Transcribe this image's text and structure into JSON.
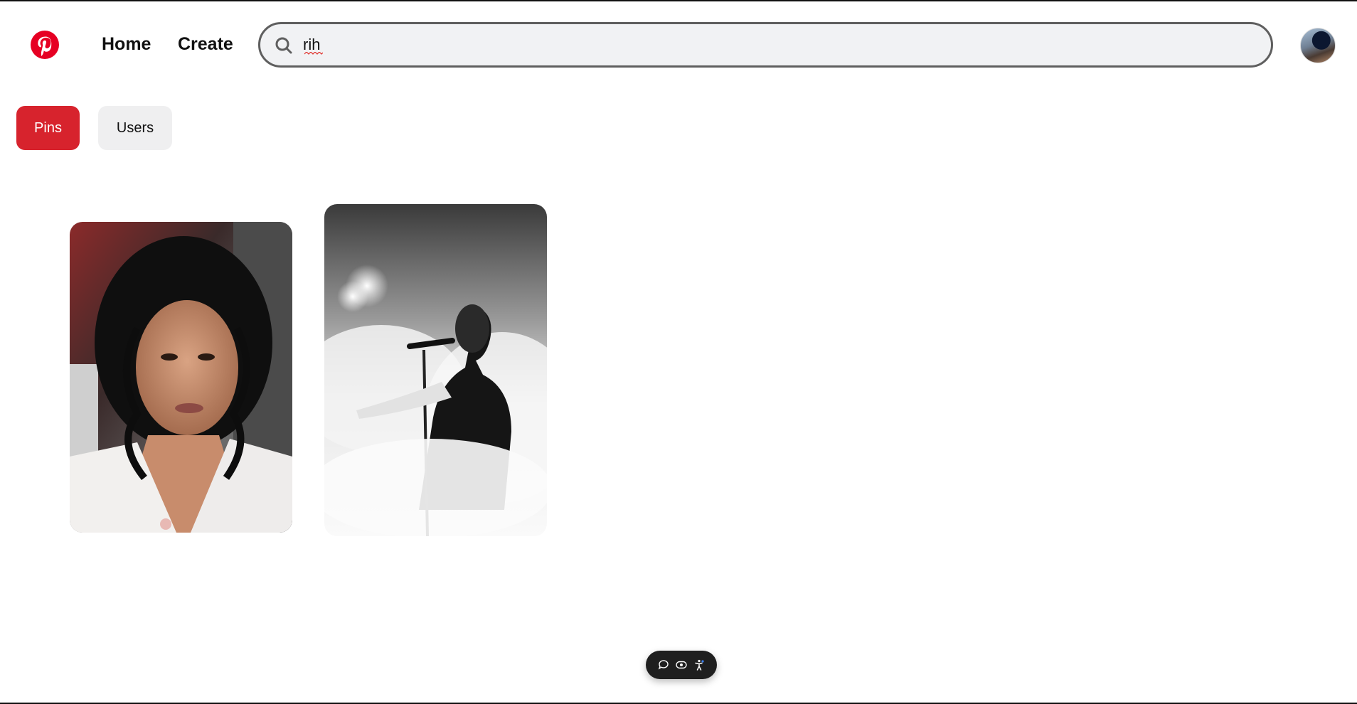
{
  "app": {
    "logo_icon": "pinterest-logo-icon",
    "brand_color": "#e60023"
  },
  "nav": {
    "home_label": "Home",
    "create_label": "Create"
  },
  "search": {
    "icon": "search-icon",
    "value": "rih",
    "placeholder": ""
  },
  "profile": {
    "avatar_icon": "user-avatar"
  },
  "tabs": [
    {
      "label": "Pins",
      "active": true,
      "color": "#d7232d"
    },
    {
      "label": "Users",
      "active": false,
      "color": "#efeff0"
    }
  ],
  "pins": [
    {
      "id": "pin-1",
      "description_icon": "portrait-photo"
    },
    {
      "id": "pin-2",
      "description_icon": "singer-photo"
    }
  ],
  "floating_toolbar": {
    "buttons": [
      "comment-icon",
      "eye-icon",
      "accessibility-icon"
    ]
  }
}
